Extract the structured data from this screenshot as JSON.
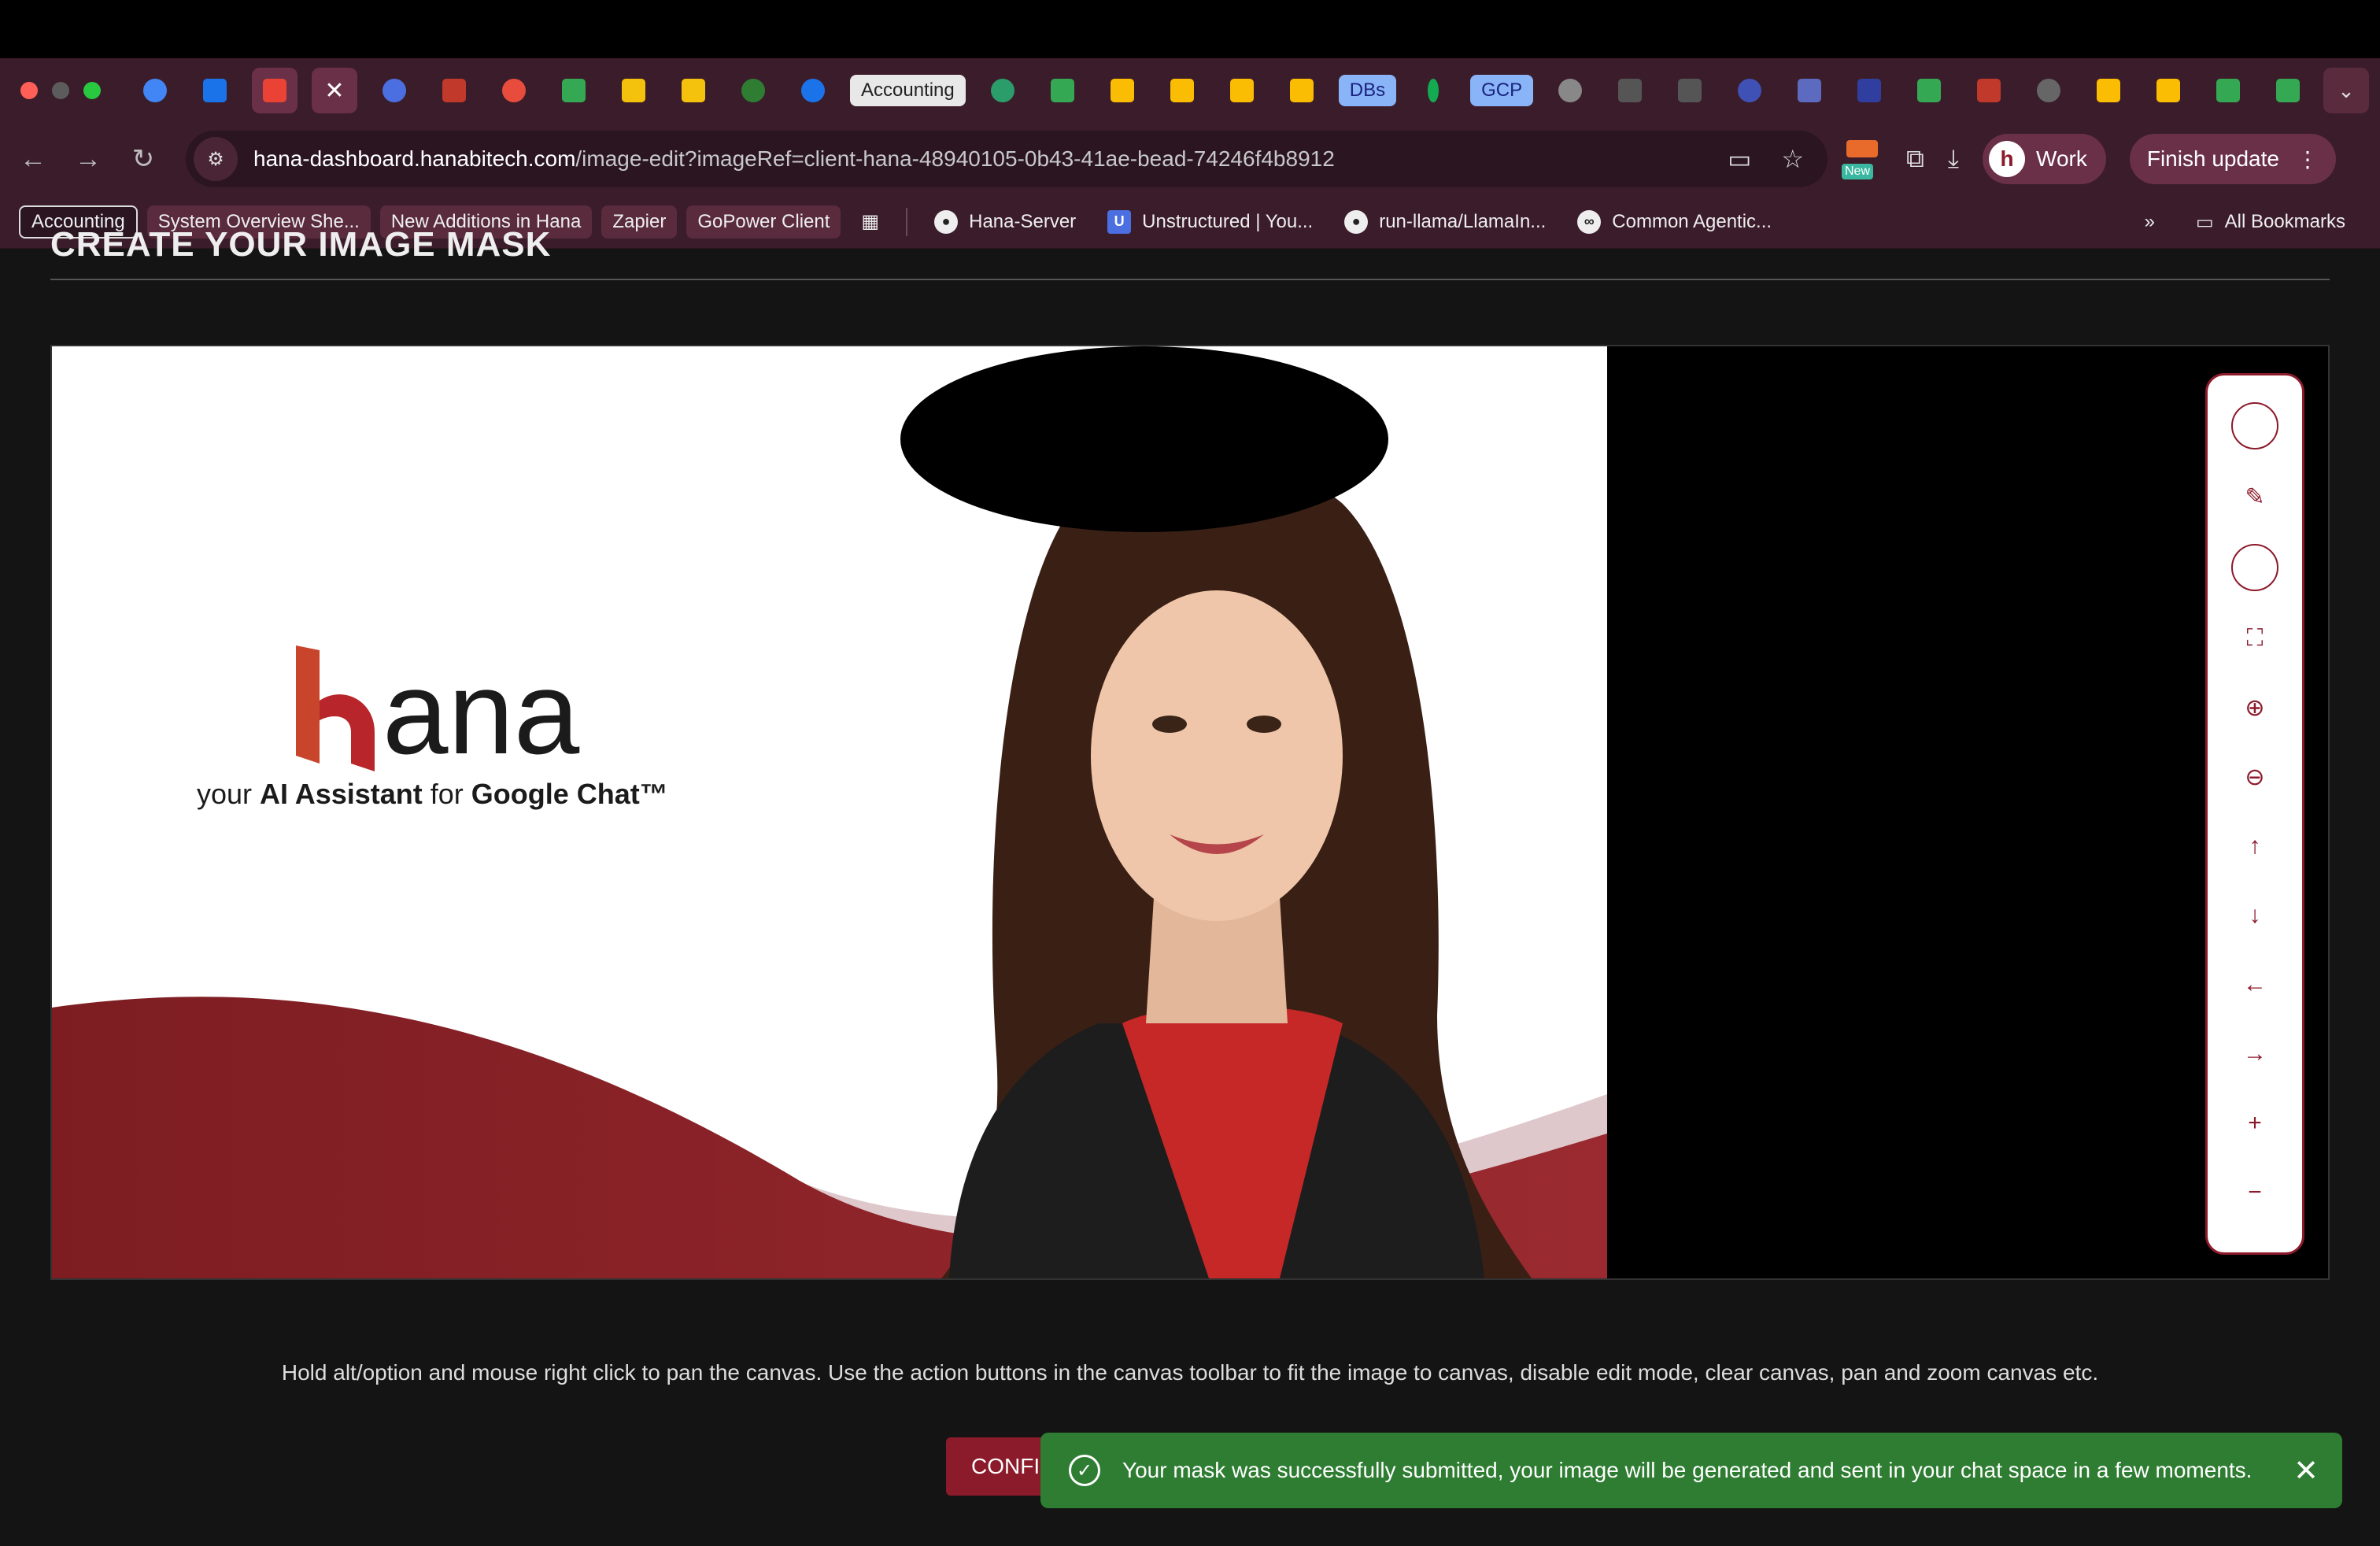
{
  "browser": {
    "tabs": {
      "accounting_label": "Accounting",
      "dbs_label": "DBs",
      "gcp_label": "GCP",
      "close_glyph": "✕",
      "new_tab_glyph": "+"
    },
    "address": {
      "domain": "hana-dashboard.hanabitech.com",
      "path": "/image-edit?imageRef=client-hana-48940105-0b43-41ae-bead-74246f4b8912"
    },
    "new_badge": "New",
    "profile_label": "Work",
    "profile_initial": "h",
    "finish_update_label": "Finish update",
    "bookmarks": [
      "Accounting",
      "System Overview She...",
      "New Additions in Hana",
      "Zapier",
      "GoPower Client",
      "Hana-Server",
      "Unstructured | You...",
      "run-llama/LlamaIn...",
      "Common Agentic..."
    ],
    "all_bookmarks_label": "All Bookmarks",
    "unstructured_icon_letter": "U"
  },
  "page": {
    "heading": "CREATE YOUR IMAGE MASK",
    "helper_text": "Hold alt/option and mouse right click to pan the canvas. Use the action buttons in the canvas toolbar to fit the image to canvas, disable edit mode, clear canvas, pan and zoom canvas etc.",
    "confirm_label": "CONFIRM",
    "toast_message": "Your mask was successfully submitted, your image will be generated and sent in your chat space in a few moments."
  },
  "image": {
    "logo_text": "ana",
    "tagline_prefix": "your ",
    "tagline_bold1": "AI Assistant",
    "tagline_mid": " for ",
    "tagline_bold2": "Google Chat™"
  },
  "colors": {
    "brand": "#8b1a2b",
    "toast": "#2e7d32",
    "tab_strip": "#3b1c2a"
  }
}
